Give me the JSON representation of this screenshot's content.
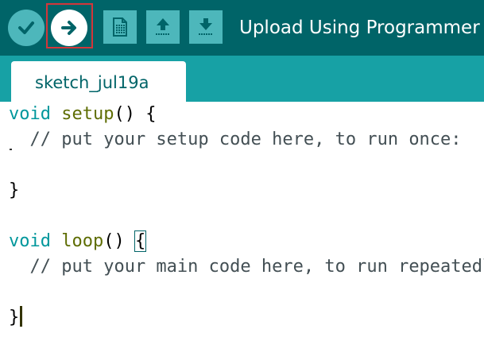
{
  "toolbar": {
    "status_text": "Upload Using Programmer",
    "buttons": [
      {
        "name": "verify",
        "icon": "checkmark-icon"
      },
      {
        "name": "upload",
        "icon": "arrow-right-icon"
      },
      {
        "name": "new",
        "icon": "new-sketch-icon"
      },
      {
        "name": "open",
        "icon": "arrow-up-icon"
      },
      {
        "name": "save",
        "icon": "arrow-down-icon"
      }
    ]
  },
  "tabs": [
    {
      "label": "sketch_jul19a"
    }
  ],
  "code": {
    "setup_kw": "void",
    "setup_fn": "setup",
    "setup_rest": "() {",
    "setup_comment": "  // put your setup code here, to run once:",
    "setup_close": "}",
    "loop_kw": "void",
    "loop_fn": "loop",
    "loop_rest": "() ",
    "loop_open_brace": "{",
    "loop_comment": "  // put your main code here, to run repeatedly:",
    "loop_close": "}"
  },
  "colors": {
    "toolbar_bg": "#006468",
    "tabbar_bg": "#17a1a5",
    "button_bg": "#4db7bb",
    "keyword": "#00979c",
    "function": "#5e6d03",
    "highlight_frame": "#d4363a"
  }
}
